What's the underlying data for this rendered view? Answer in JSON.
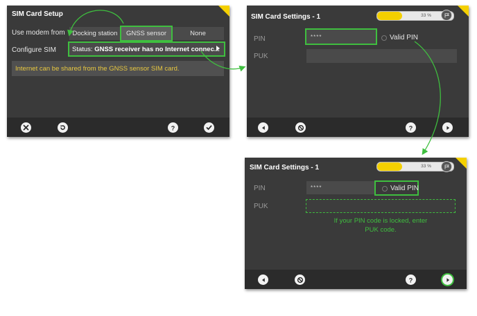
{
  "sim_setup": {
    "title": "SIM Card Setup",
    "use_modem_label": "Use modem from",
    "modem_options": [
      "Docking station",
      "GNSS sensor",
      "None"
    ],
    "selected_modem": "GNSS sensor",
    "configure_label": "Configure SIM",
    "status_prefix": "Status: ",
    "status_text": "GNSS receiver has no Internet connec...",
    "info_text": "Internet can be shared from the GNSS sensor SIM card.",
    "buttons": [
      "cancel-icon",
      "reset-icon",
      "help-icon",
      "confirm-icon"
    ]
  },
  "sim_settings_1": {
    "title": "SIM Card Settings - 1",
    "progress_percent": 33,
    "progress_label": "33 %",
    "pin_label": "PIN",
    "pin_value": "****",
    "valid_pin_label": "Valid PIN",
    "puk_label": "PUK",
    "puk_value": "",
    "buttons": [
      "back-icon",
      "cancel-icon",
      "help-icon",
      "next-icon"
    ]
  },
  "sim_settings_2": {
    "title": "SIM Card Settings - 1",
    "progress_percent": 33,
    "progress_label": "33 %",
    "pin_label": "PIN",
    "pin_value": "****",
    "valid_pin_label": "Valid PIN",
    "puk_label": "PUK",
    "puk_value": "",
    "note_line1": "If your PIN code is locked, enter",
    "note_line2": "PUK code.",
    "buttons": [
      "back-icon",
      "cancel-icon",
      "help-icon",
      "next-icon"
    ]
  },
  "colors": {
    "panel_bg": "#3a3a3a",
    "accent_yellow": "#f4d000",
    "highlight_green": "#3fbf3f",
    "info_text": "#e8c840"
  }
}
